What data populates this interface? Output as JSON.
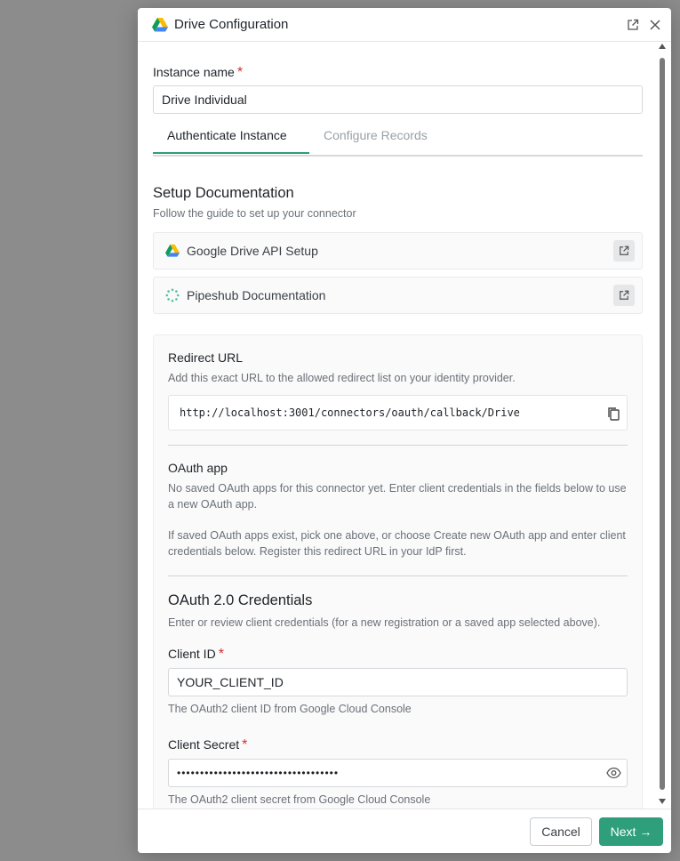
{
  "dialog": {
    "title": "Drive Configuration",
    "icons": {
      "logo": "google-drive-icon",
      "popout": "open-in-new-icon",
      "close": "close-icon"
    }
  },
  "instance": {
    "label": "Instance name",
    "required_mark": "*",
    "value": "Drive Individual"
  },
  "tabs": [
    {
      "label": "Authenticate Instance",
      "active": true
    },
    {
      "label": "Configure Records",
      "active": false
    }
  ],
  "setup_docs": {
    "title": "Setup Documentation",
    "subtitle": "Follow the guide to set up your connector",
    "items": [
      {
        "label": "Google Drive API Setup",
        "icon": "google-drive-icon"
      },
      {
        "label": "Pipeshub Documentation",
        "icon": "pipeshub-icon"
      }
    ]
  },
  "redirect": {
    "title": "Redirect URL",
    "description": "Add this exact URL to the allowed redirect list on your identity provider.",
    "url": "http://localhost:3001/connectors/oauth/callback/Drive"
  },
  "oauth_app": {
    "title": "OAuth app",
    "line1": "No saved OAuth apps for this connector yet. Enter client credentials in the fields below to use",
    "line2": "a new OAuth app.",
    "line3": "If saved OAuth apps exist, pick one above, or choose Create new OAuth app and enter client",
    "line4": "credentials below. Register this redirect URL in your IdP first."
  },
  "credentials": {
    "title": "OAuth 2.0 Credentials",
    "subtitle": "Enter or review client credentials (for a new registration or a saved app selected above).",
    "client_id": {
      "label": "Client ID",
      "required_mark": "*",
      "value": "YOUR_CLIENT_ID",
      "help": "The OAuth2 client ID from Google Cloud Console"
    },
    "client_secret": {
      "label": "Client Secret",
      "required_mark": "*",
      "value": "•••••••••••••••••••••••••••••••••••",
      "help": "The OAuth2 client secret from Google Cloud Console"
    }
  },
  "footer": {
    "cancel": "Cancel",
    "next": "Next →"
  },
  "colors": {
    "accent": "#2e9e7b",
    "required": "#d32f2f",
    "overlay": "#8c8c8c"
  }
}
